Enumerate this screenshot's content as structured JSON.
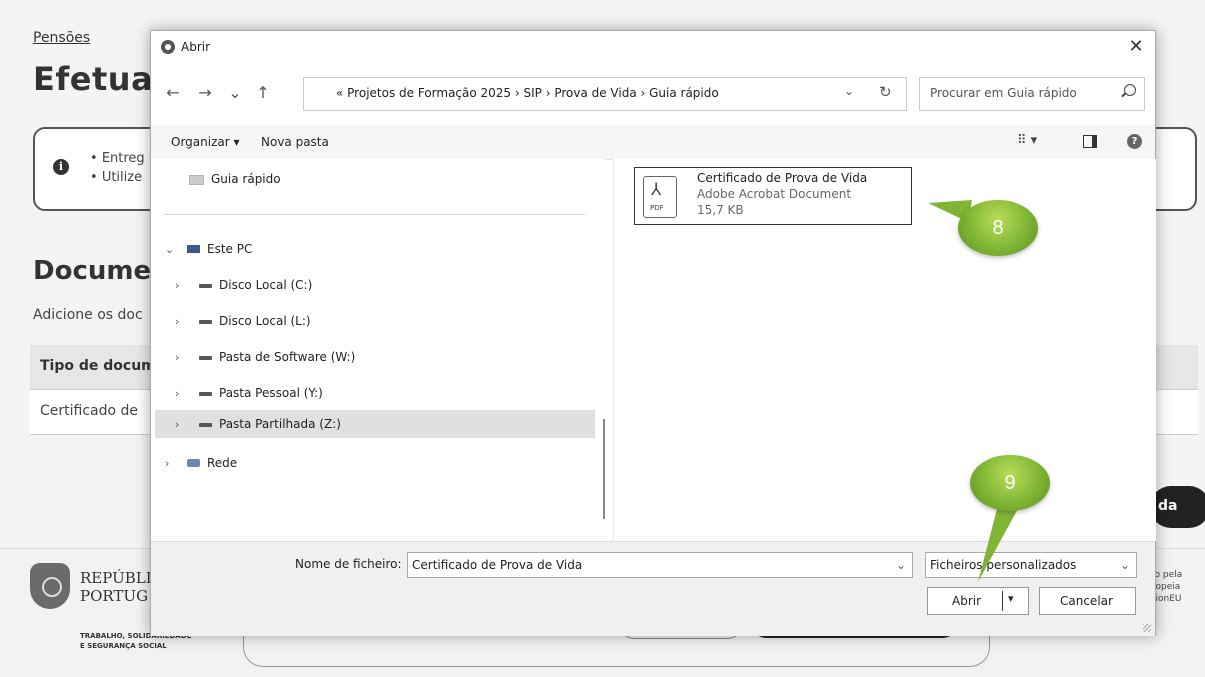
{
  "background": {
    "breadcrumb": "Pensões",
    "title": "Efetua",
    "info_bullets": [
      "Entreg",
      "Utilize"
    ],
    "section_title": "Docume",
    "section_sub": "Adicione os doc",
    "table_header": "Tipo de docum",
    "table_row": "Certificado de",
    "dark_button": "da",
    "footer": {
      "republic_line1": "REPÚBLI",
      "republic_line2": "PORTUG",
      "ministry_line1": "TRABALHO, SOLIDARIEDADE",
      "ministry_line2": "E SEGURANÇA SOCIAL",
      "eu_line1": "lo pela",
      "eu_line2": "ropeia",
      "eu_line3": "tionEU"
    }
  },
  "dialog": {
    "title": "Abrir",
    "nav": {
      "back": "←",
      "forward": "→",
      "recent": "⌄",
      "up": "↑"
    },
    "address": {
      "path": "«  Projetos de Formação 2025  ›  SIP  ›  Prova de Vida  ›  Guia rápido",
      "dropdown": "⌄",
      "refresh": "↻"
    },
    "search": {
      "placeholder": "Procurar em Guia rápido"
    },
    "commands": {
      "organize": "Organizar ▾",
      "new_folder": "Nova pasta",
      "view": "⠿ ▾",
      "help": "?"
    },
    "nav_pane": {
      "quick": "Guia rápido",
      "this_pc": "Este PC",
      "drives": [
        "Disco Local (C:)",
        "Disco Local (L:)",
        "Pasta de Software (W:)",
        "Pasta Pessoal (Y:)",
        "Pasta Partilhada (Z:)"
      ],
      "network": "Rede",
      "chev_right": "›",
      "chev_down": "⌄"
    },
    "file": {
      "name": "Certificado de Prova de Vida",
      "type": "Adobe Acrobat Document",
      "size": "15,7 KB",
      "icon_label": "PDF"
    },
    "bottom": {
      "filename_label": "Nome de ficheiro:",
      "filename_value": "Certificado de Prova de Vida",
      "filetype": "Ficheiros personalizados",
      "open": "Abrir",
      "cancel": "Cancelar",
      "dd": "⌄"
    }
  },
  "callouts": {
    "first": "8",
    "second": "9",
    "color": "#7fb534"
  }
}
